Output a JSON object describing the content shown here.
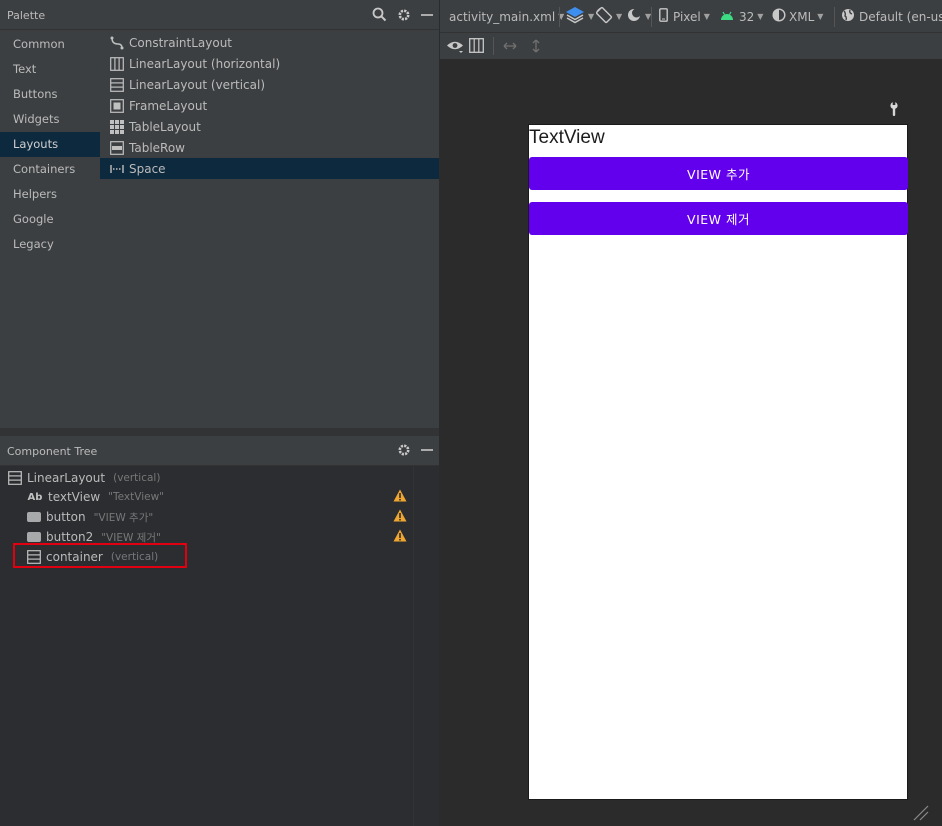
{
  "palette": {
    "title": "Palette",
    "categories": [
      "Common",
      "Text",
      "Buttons",
      "Widgets",
      "Layouts",
      "Containers",
      "Helpers",
      "Google",
      "Legacy"
    ],
    "selected_category": "Layouts",
    "items": [
      "ConstraintLayout",
      "LinearLayout (horizontal)",
      "LinearLayout (vertical)",
      "FrameLayout",
      "TableLayout",
      "TableRow",
      "Space"
    ],
    "selected_item": "Space"
  },
  "component_tree": {
    "title": "Component Tree",
    "nodes": [
      {
        "name": "LinearLayout",
        "detail": "(vertical)",
        "warning": false
      },
      {
        "name": "textView",
        "detail": "\"TextView\"",
        "warning": true
      },
      {
        "name": "button",
        "detail": "\"VIEW 추가\"",
        "warning": true
      },
      {
        "name": "button2",
        "detail": "\"VIEW 제거\"",
        "warning": true
      },
      {
        "name": "container",
        "detail": "(vertical)",
        "warning": false
      }
    ]
  },
  "toolbar": {
    "file": "activity_main.xml",
    "device": "Pixel",
    "api": "32",
    "mode": "XML",
    "locale": "Default (en-us)"
  },
  "preview": {
    "textview": "TextView",
    "button1": "VIEW 추가",
    "button2": "VIEW 제거",
    "button_color": "#6200ee"
  }
}
